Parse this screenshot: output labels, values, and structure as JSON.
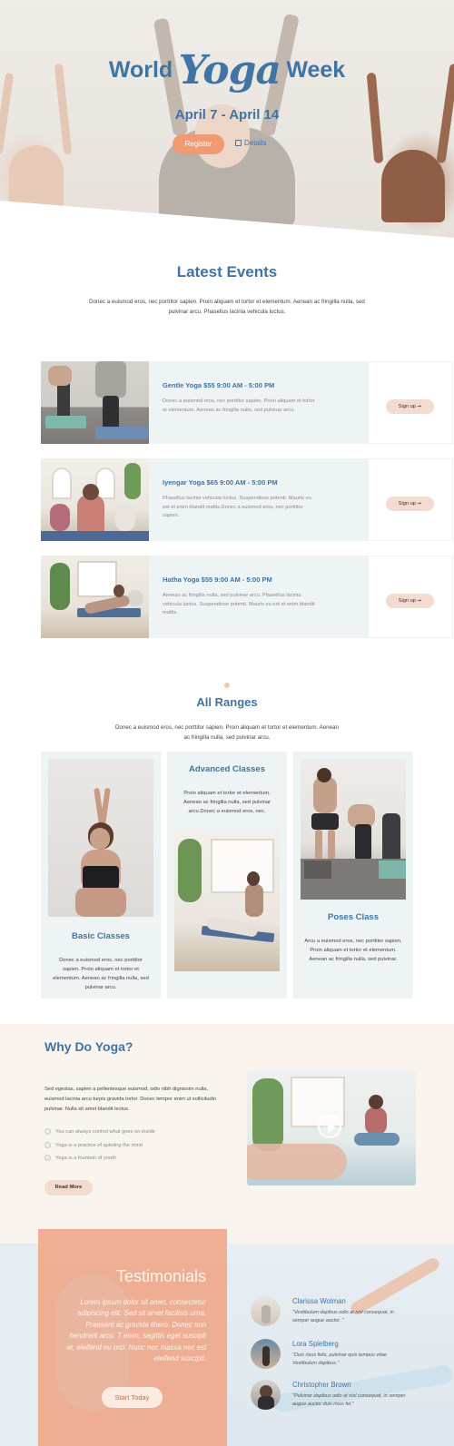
{
  "hero": {
    "title_pre": "World",
    "title_script": "Yoga",
    "title_post": "Week",
    "date": "April 7 - April 14",
    "register_label": "Register",
    "details_label": "Details",
    "details_icon": "calendar-icon"
  },
  "events": {
    "title": "Latest Events",
    "intro": "Donec a euismod eros, nec porttitor sapien. Proin aliquam et tortor et elementum. Aenean ac fringilla nulla, sed pulvinar arcu. Phasellus lacinia vehicula luctus.",
    "items": [
      {
        "title": "Gentle Yoga $55 9:00 AM - 5:00 PM",
        "text": "Donec a euismod eros, nec porttitor sapien. Proin aliquam et tortor et elementum. Aenean ac fringilla nulla, sed pulvinar arcu.",
        "button": "Sign up ➞"
      },
      {
        "title": "Iyengar Yoga $65 9:00 AM - 5:00 PM",
        "text": "Phasellus lacinia vehicula luctus. Suspendisse potenti. Mauris eu est et enim blandit mattis.Donec a euismod eros, nec porttitor sapien.",
        "button": "Sign up ➞"
      },
      {
        "title": "Hatha Yoga $55 9:00 AM - 5:00 PM",
        "text": "Aenean ac fringilla nulla, sed pulvinar arcu. Phasellus lacinia vehicula luctus. Suspendisse potenti. Mauris eu est et enim blandit mattis.",
        "button": "Sign up ➞"
      }
    ]
  },
  "ranges": {
    "title": "All Ranges",
    "intro": "Donec a euismod eros, nec porttitor sapien. Proin aliquam et tortor et elementum. Aenean ac fringilla nulla, sed pulvinar arcu.",
    "basic_title": "Basic Classes",
    "basic_text": "Donec a euismod eros, nec porttitor sapien. Proin aliquam et tortor et elementum. Aenean ac fringilla nulla, sed pulvinar arcu.",
    "advanced_title": "Advanced Classes",
    "advanced_text": "Proin aliquam et tortor et elementum. Aenean ac fringilla nulla, sed pulvinar arcu.Donec a euismod eros, nec.",
    "poses_title": "Poses Class",
    "poses_text": "Arcu a euismod eros, nec porttitor sapien. Proin aliquam et tortor et elementum. Aenean ac fringilla nulla, sed pulvinar."
  },
  "why": {
    "title": "Why Do Yoga?",
    "text": "Sed egestas, sapien a pellentesque euismod, odio nibh dignissim nulla, euismod lacinia arcu turpis gravida tortor. Donec tempor enim ut sollicitudin pulvinar. Nulla sit amet blandit lectus.",
    "items": [
      "You can always control what goes on inside",
      "Yoga is a practice of quieting the mind",
      "Yoga is a fountain of youth"
    ],
    "button": "Read More",
    "play_icon": "play-icon"
  },
  "testimonials": {
    "title": "Testimonials",
    "quote": "Lorem ipsum dolor sit amet, consectetur adipiscing elit. Sed sit amet facilisis urna. Praesent ac gravida libero. Donec non hendrerit arcu. T enim, sagittis eget suscipit et, eleifend eu orci. Nunc nec massa nec est eleifend suscipit.",
    "button": "Start Today",
    "people": [
      {
        "name": "Clarissa Wolman",
        "quote": "\"Vestibulum dapibus odio at nisl consequat, in semper augue auctor. \""
      },
      {
        "name": "Lora Spielberg",
        "quote": "\"Duis risus felis, pulvinar quis tempus vitae Vestibulum dapibus.\""
      },
      {
        "name": "Christopher Brown",
        "quote": "\"Pulvinar dapibus odio at nisl consequat, in semper augue auctor duis risus fel.\""
      }
    ]
  },
  "colors": {
    "accent": "#3f74a3",
    "cta": "#ef9a72",
    "soft": "#f4dbcf",
    "panel": "#eef4f4"
  }
}
